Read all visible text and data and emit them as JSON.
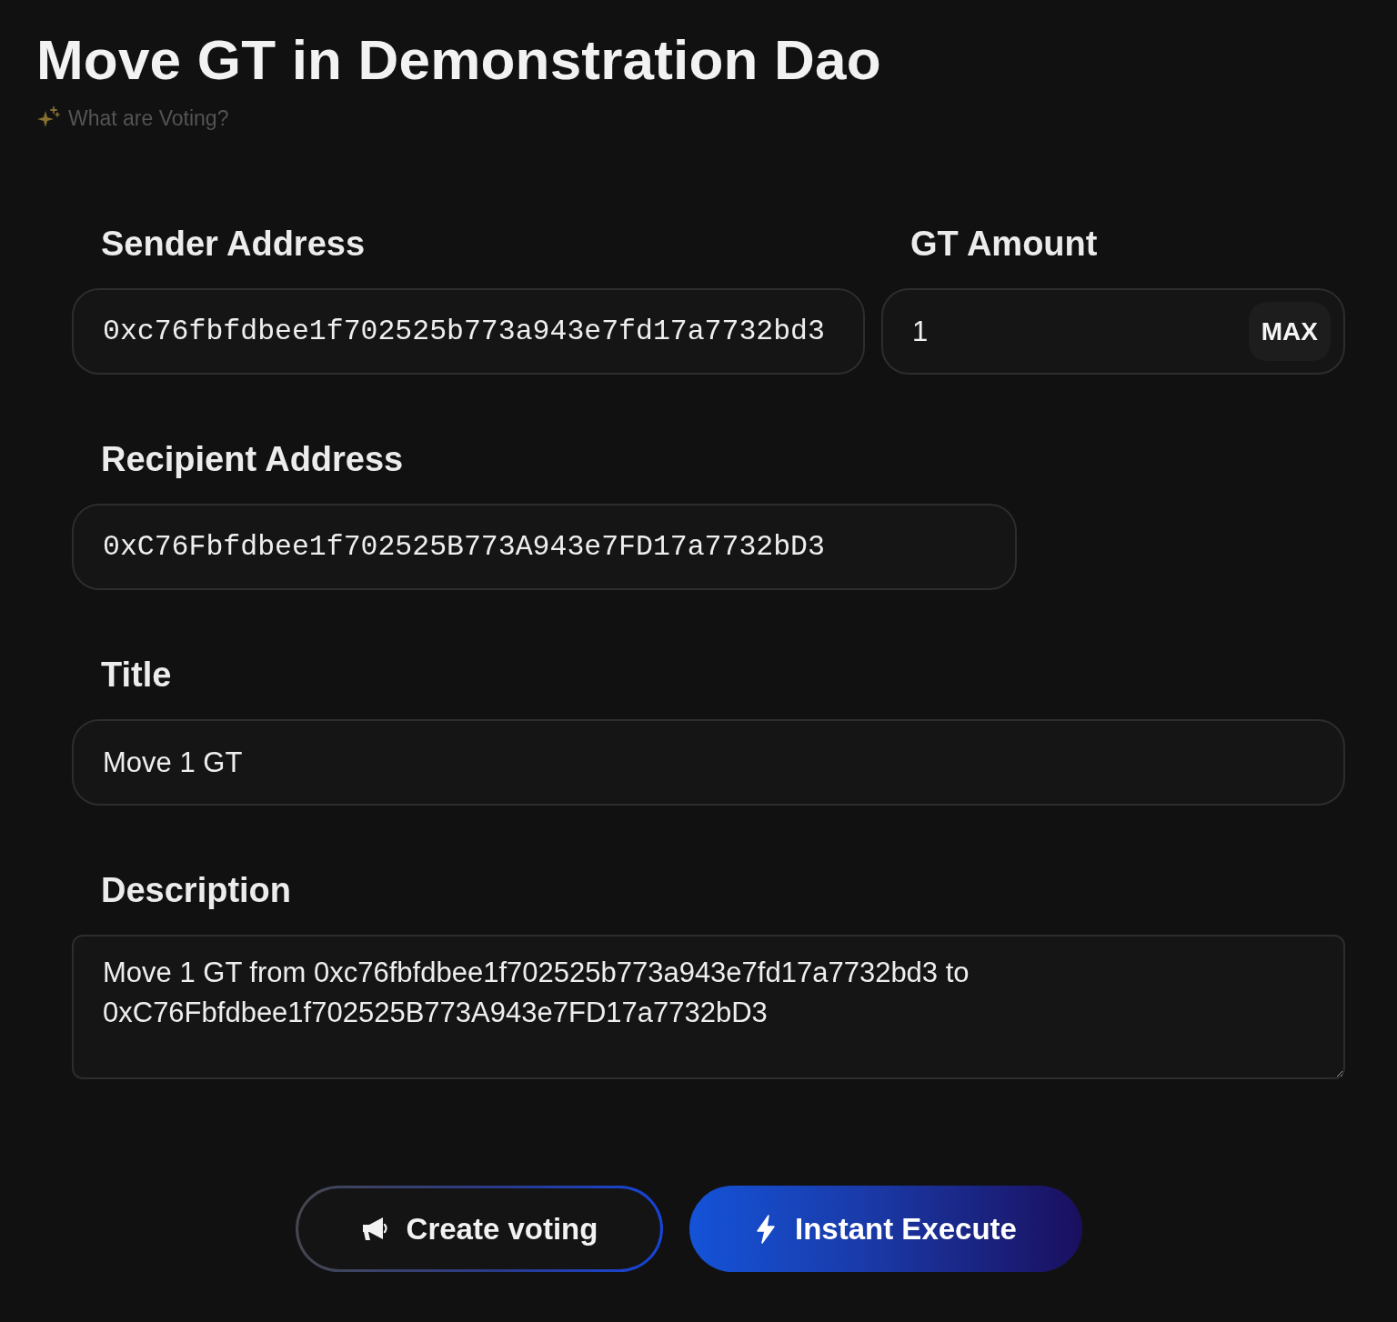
{
  "page": {
    "title": "Move GT in Demonstration Dao",
    "help_link": "What are Voting?"
  },
  "sender_address": {
    "label": "Sender Address",
    "value": "0xc76fbfdbee1f702525b773a943e7fd17a7732bd3"
  },
  "gt_amount": {
    "label": "GT Amount",
    "value": "1",
    "max_button": "MAX"
  },
  "recipient_address": {
    "label": "Recipient Address",
    "value": "0xC76Fbfdbee1f702525B773A943e7FD17a7732bD3"
  },
  "title_field": {
    "label": "Title",
    "value": "Move 1 GT"
  },
  "description": {
    "label": "Description",
    "value": "Move 1 GT from 0xc76fbfdbee1f702525b773a943e7fd17a7732bd3 to 0xC76Fbfdbee1f702525B773A943e7FD17a7732bD3"
  },
  "buttons": [
    {
      "kind": "outline",
      "label": "Create voting"
    },
    {
      "kind": "filled",
      "label": "Instant Execute"
    }
  ]
}
